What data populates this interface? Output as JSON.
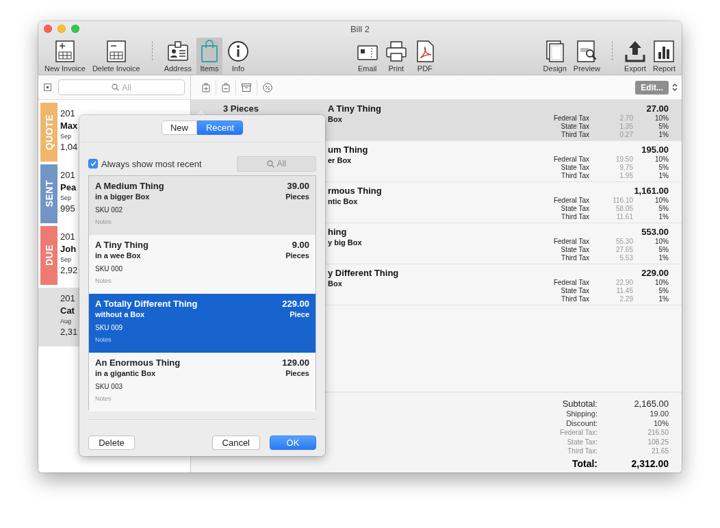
{
  "window": {
    "title": "Bill 2"
  },
  "toolbar": {
    "left": [
      {
        "label": "New Invoice",
        "kind": "new-invoice",
        "selected": false
      },
      {
        "label": "Delete Invoice",
        "kind": "delete-invoice",
        "selected": false
      },
      {
        "label": "Address",
        "kind": "address",
        "selected": false
      },
      {
        "label": "Items",
        "kind": "items",
        "selected": true
      },
      {
        "label": "Info",
        "kind": "info",
        "selected": false
      }
    ],
    "center": [
      {
        "label": "Email",
        "kind": "email",
        "selected": false
      },
      {
        "label": "Print",
        "kind": "print",
        "selected": false
      },
      {
        "label": "PDF",
        "kind": "pdf",
        "selected": false
      }
    ],
    "right": [
      {
        "label": "Design",
        "kind": "design",
        "selected": false
      },
      {
        "label": "Preview",
        "kind": "preview",
        "selected": false
      },
      {
        "label": "Export",
        "kind": "export",
        "selected": false
      },
      {
        "label": "Report",
        "kind": "report",
        "selected": false
      }
    ]
  },
  "sidebar": {
    "search": {
      "placeholder": "All"
    },
    "invoices": [
      {
        "status": "QUOTE",
        "color": "#f0b66c",
        "year": "201",
        "name": "Max",
        "date": "Sep",
        "amount": "1,04",
        "selected": false
      },
      {
        "status": "SENT",
        "color": "#7195c5",
        "year": "201",
        "name": "Pea",
        "date": "Sep",
        "amount": "995",
        "selected": false
      },
      {
        "status": "DUE",
        "color": "#ee7b72",
        "year": "201",
        "name": "Joh",
        "date": "Sep",
        "amount": "2,92",
        "selected": false
      },
      {
        "year": "201",
        "name": "Cat",
        "date": "Aug",
        "amount": "2,31",
        "selected": true
      }
    ]
  },
  "items_bar": {
    "edit_button": "Edit..."
  },
  "items": [
    {
      "quantity": "3 Pieces",
      "title": "A Tiny Thing",
      "subtitle": "Box",
      "amount": "27.00",
      "selected": true,
      "taxes": [
        {
          "name": "Federal Tax",
          "amount": "2.70",
          "rate": "10%"
        },
        {
          "name": "State Tax",
          "amount": "1.35",
          "rate": "5%"
        },
        {
          "name": "Third Tax",
          "amount": "0.27",
          "rate": "1%"
        }
      ]
    },
    {
      "title": "um Thing",
      "subtitle": "er Box",
      "amount": "195.00",
      "selected": false,
      "taxes": [
        {
          "name": "Federal Tax",
          "amount": "19.50",
          "rate": "10%"
        },
        {
          "name": "State Tax",
          "amount": "9.75",
          "rate": "5%"
        },
        {
          "name": "Third Tax",
          "amount": "1.95",
          "rate": "1%"
        }
      ]
    },
    {
      "title": "rmous Thing",
      "subtitle": "ntic Box",
      "amount": "1,161.00",
      "selected": false,
      "taxes": [
        {
          "name": "Federal Tax",
          "amount": "116.10",
          "rate": "10%"
        },
        {
          "name": "State Tax",
          "amount": "58.05",
          "rate": "5%"
        },
        {
          "name": "Third Tax",
          "amount": "11.61",
          "rate": "1%"
        }
      ]
    },
    {
      "title": "hing",
      "subtitle": "y big Box",
      "amount": "553.00",
      "selected": false,
      "taxes": [
        {
          "name": "Federal Tax",
          "amount": "55.30",
          "rate": "10%"
        },
        {
          "name": "State Tax",
          "amount": "27.65",
          "rate": "5%"
        },
        {
          "name": "Third Tax",
          "amount": "5.53",
          "rate": "1%"
        }
      ]
    },
    {
      "title": "y Different Thing",
      "subtitle": "Box",
      "amount": "229.00",
      "selected": false,
      "taxes": [
        {
          "name": "Federal Tax",
          "amount": "22.90",
          "rate": "10%"
        },
        {
          "name": "State Tax",
          "amount": "11.45",
          "rate": "5%"
        },
        {
          "name": "Third Tax",
          "amount": "2.29",
          "rate": "1%"
        }
      ]
    }
  ],
  "totals": [
    {
      "label": "Subtotal:",
      "value": "2,165.00",
      "kind": "main"
    },
    {
      "label": "Shipping:",
      "value": "19.00",
      "kind": "sub"
    },
    {
      "label": "Discount:",
      "value": "10%",
      "kind": "sub"
    },
    {
      "label": "Federal Tax:",
      "value": "216.50",
      "kind": "tax"
    },
    {
      "label": "State Tax:",
      "value": "108.25",
      "kind": "tax"
    },
    {
      "label": "Third Tax:",
      "value": "21.65",
      "kind": "tax"
    },
    {
      "label": "Total:",
      "value": "2,312.00",
      "kind": "total"
    }
  ],
  "popover": {
    "segments": [
      {
        "label": "New",
        "selected": false
      },
      {
        "label": "Recent",
        "selected": true
      }
    ],
    "always_show": {
      "label": "Always show most recent",
      "checked": true
    },
    "search": {
      "placeholder": "All",
      "disabled": true
    },
    "items": [
      {
        "title": "A Medium Thing",
        "subtitle": "in a bigger Box",
        "sku": "SKU 002",
        "notes": "Notes",
        "price": "39.00",
        "unit": "Pieces",
        "highlighted": true,
        "selected": false
      },
      {
        "title": "A Tiny Thing",
        "subtitle": "in a wee Box",
        "sku": "SKU 000",
        "notes": "Notes",
        "price": "9.00",
        "unit": "Pieces",
        "highlighted": false,
        "selected": false
      },
      {
        "title": "A Totally Different Thing",
        "subtitle": "without a Box",
        "sku": "SKU 009",
        "notes": "Notes",
        "price": "229.00",
        "unit": "Piece",
        "highlighted": false,
        "selected": true
      },
      {
        "title": "An Enormous Thing",
        "subtitle": "in a gigantic Box",
        "sku": "SKU 003",
        "notes": "Notes",
        "price": "129.00",
        "unit": "Pieces",
        "highlighted": false,
        "selected": false
      }
    ],
    "buttons": [
      {
        "label": "Delete",
        "default": false
      },
      {
        "label": "Cancel",
        "default": false
      },
      {
        "label": "OK",
        "default": true
      }
    ]
  }
}
